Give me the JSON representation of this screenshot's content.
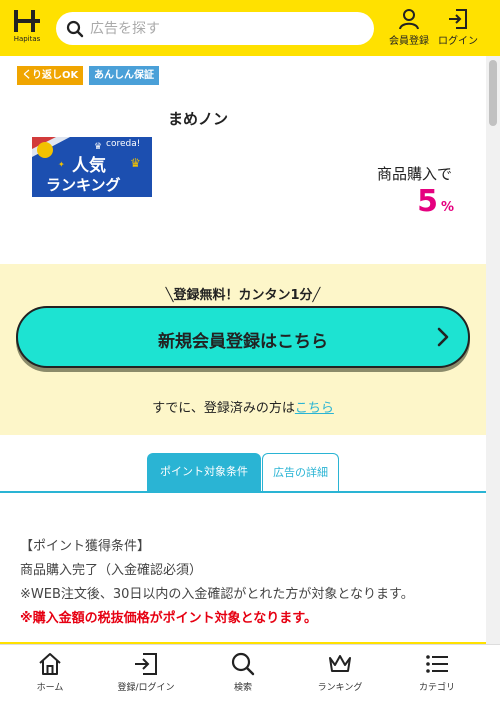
{
  "header": {
    "logo_text": "Hapitas",
    "search_placeholder": "広告を探す",
    "member_label": "会員登録",
    "login_label": "ログイン"
  },
  "badges": [
    {
      "label": "くり返しOK",
      "color": "#f0a500"
    },
    {
      "label": "あんしん保証",
      "color": "#4aa0d8"
    }
  ],
  "product": {
    "name": "まめノン",
    "banner_brand": "coreda!",
    "banner_line1": "人気",
    "banner_line2": "ランキング",
    "reward_label": "商品購入で",
    "reward_value": "5",
    "reward_unit": "%"
  },
  "register": {
    "tagline": "登録無料！カンタン1分",
    "button_label": "新規会員登録はこちら",
    "already_text": "すでに、登録済みの方は",
    "already_link": "こちら"
  },
  "tabs": [
    {
      "label": "ポイント対象条件"
    },
    {
      "label": "広告の詳細"
    }
  ],
  "conditions": {
    "heading": "【ポイント獲得条件】",
    "line1": "商品購入完了（入金確認必須）",
    "line2": "※WEB注文後、30日以内の入金確認がとれた方が対象となります。",
    "line3": "※購入金額の税抜価格がポイント対象となります。"
  },
  "bottom_nav": [
    {
      "label": "ホーム",
      "icon": "home-icon"
    },
    {
      "label": "登録/ログイン",
      "icon": "login-icon"
    },
    {
      "label": "検索",
      "icon": "search-icon"
    },
    {
      "label": "ランキング",
      "icon": "crown-icon"
    },
    {
      "label": "カテゴリ",
      "icon": "list-icon"
    }
  ],
  "colors": {
    "brand_yellow": "#ffe100",
    "accent_cyan": "#1de3d2",
    "link_blue": "#2ab4d4",
    "reward_pink": "#e5007f",
    "warning_red": "#e60012"
  }
}
